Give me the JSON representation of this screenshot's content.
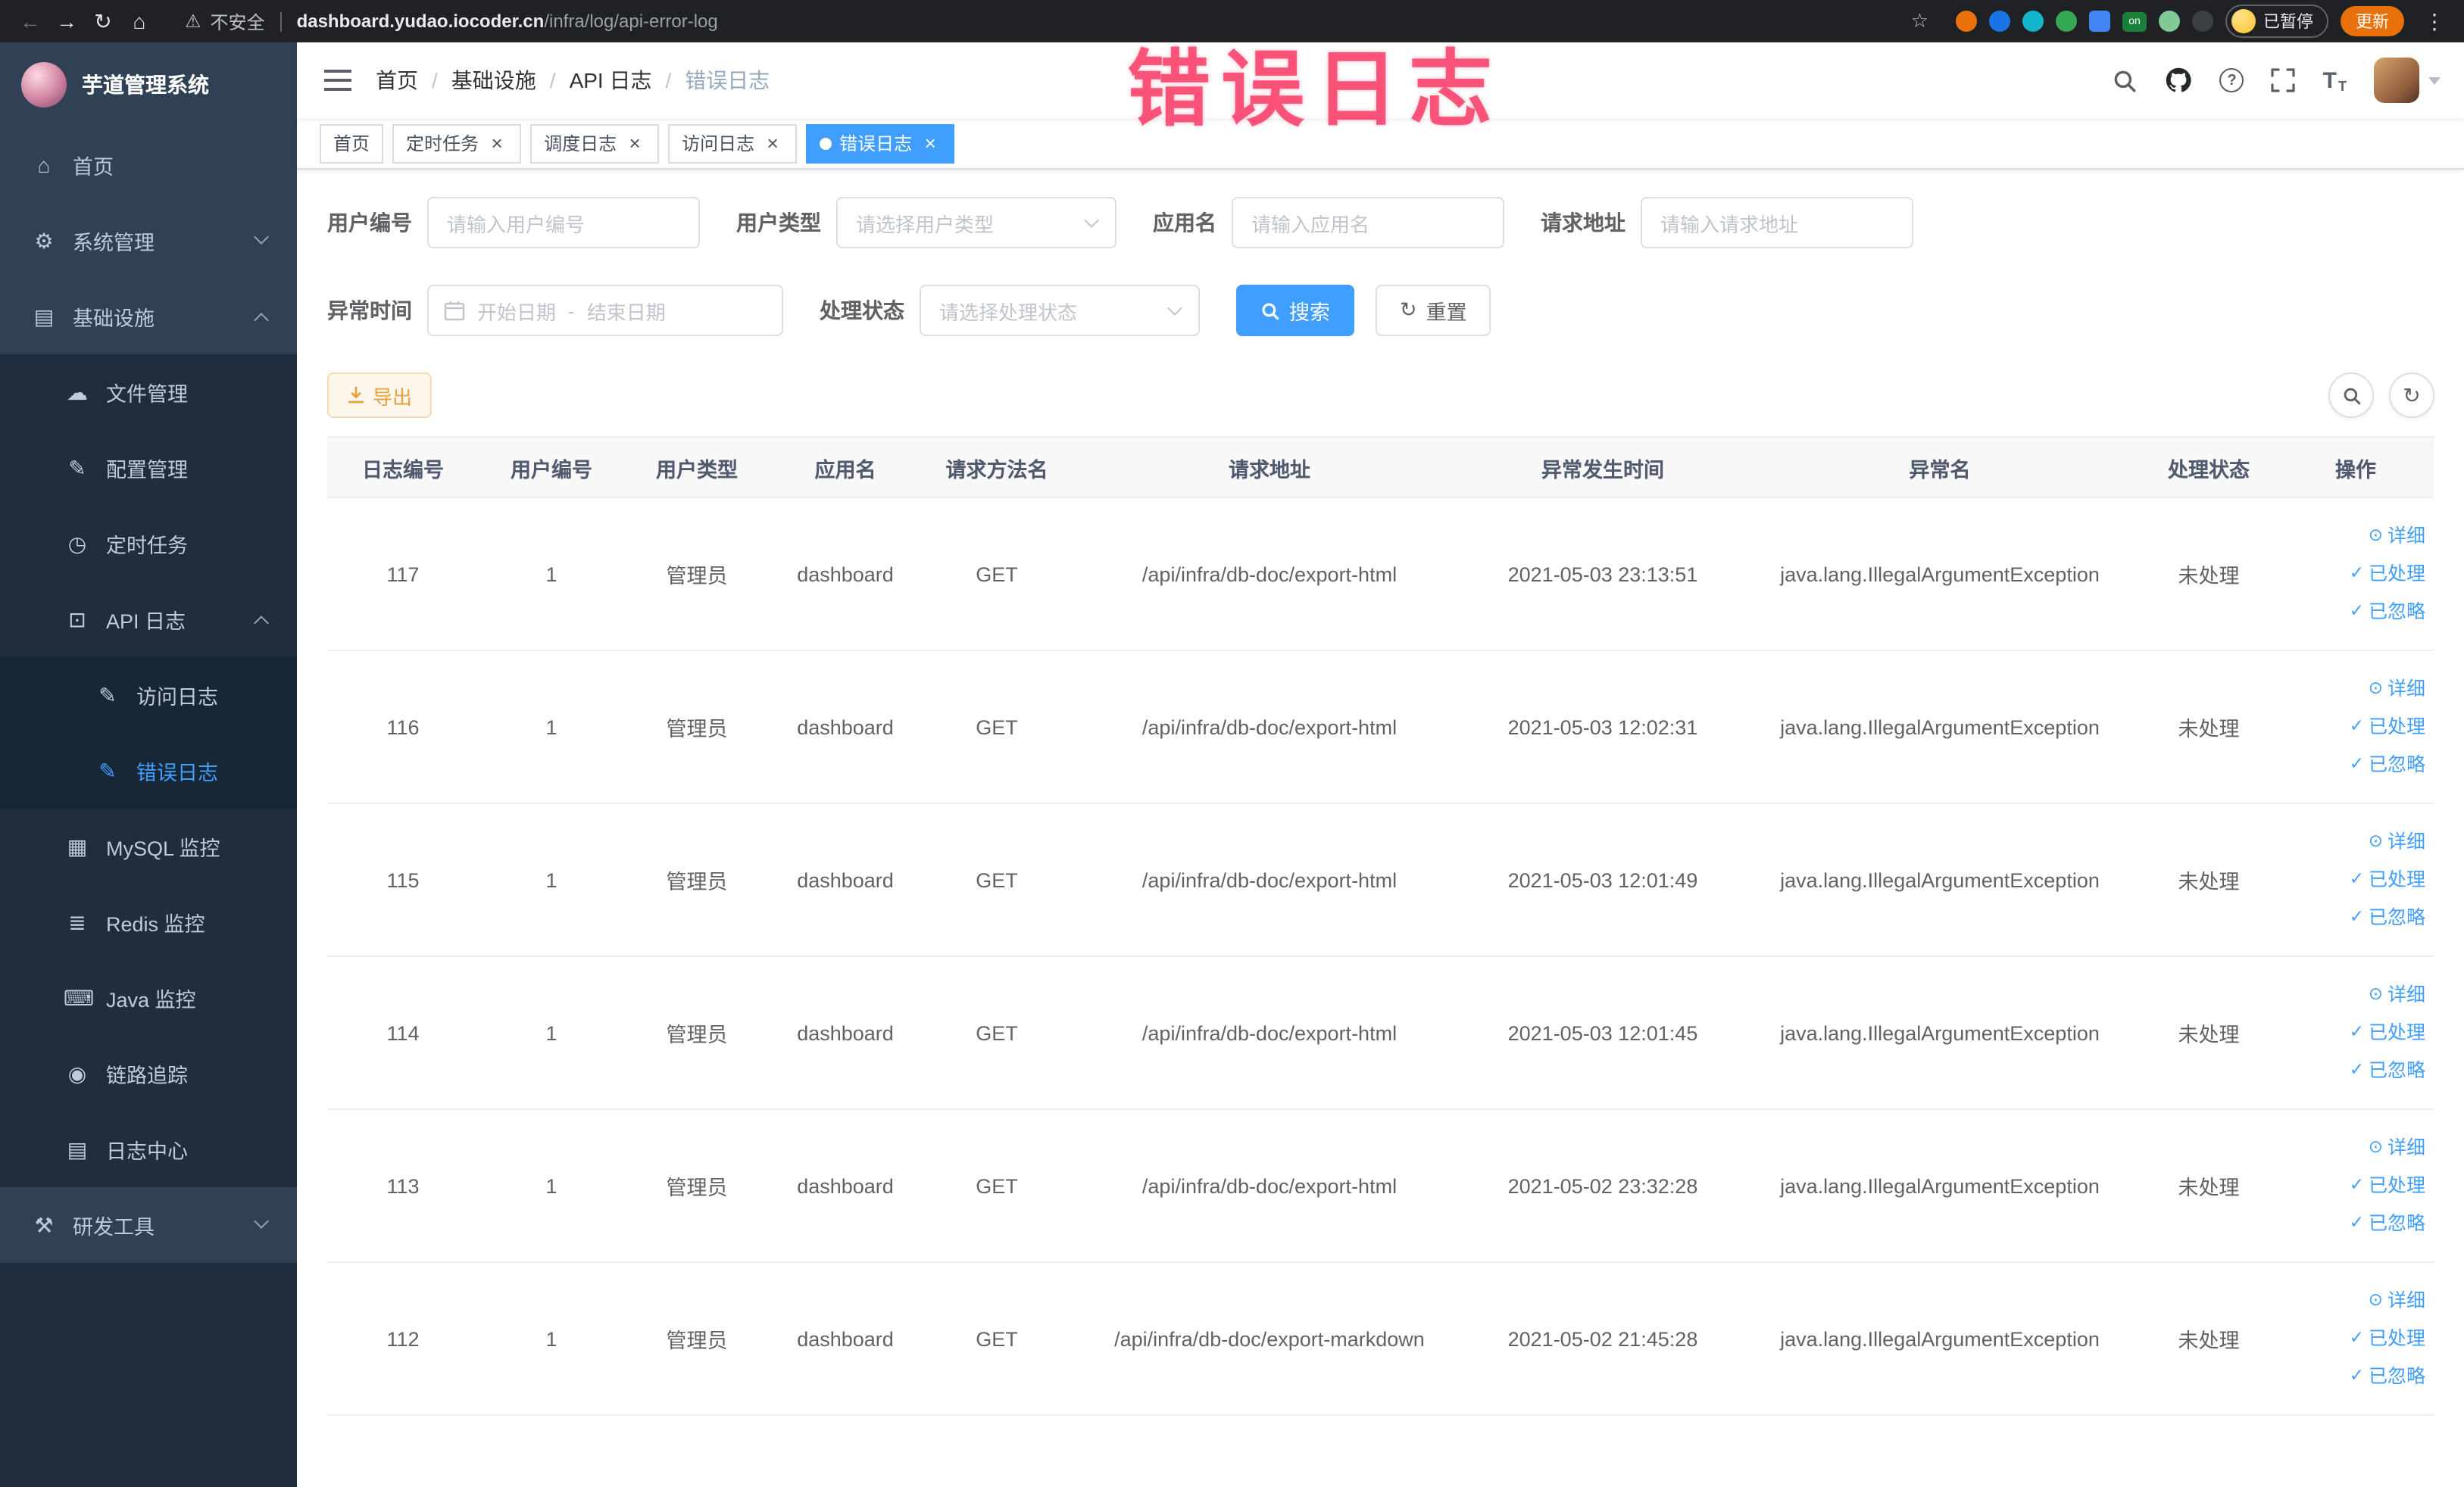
{
  "colors": {
    "accent": "#409eff",
    "warning": "#e6a23c",
    "sidebar_bg": "#304156",
    "sidebar_sub_bg": "#1f2d3d",
    "active_tag": "#409eff",
    "annotation_pink": "#f83e68"
  },
  "annotation": {
    "text": "错误日志"
  },
  "browser": {
    "security_label": "不安全",
    "url_domain": "dashboard.yudao.iocoder.cn",
    "url_path": "/infra/log/api-error-log",
    "on_badge": "on",
    "paused_badge": "已暂停",
    "update_button": "更新"
  },
  "sidebar": {
    "title": "芋道管理系统",
    "items": [
      {
        "label": "首页",
        "icon": "⌂"
      },
      {
        "label": "系统管理",
        "icon": "⚙"
      },
      {
        "label": "基础设施",
        "icon": "▤"
      },
      {
        "label": "文件管理",
        "icon": "☁"
      },
      {
        "label": "配置管理",
        "icon": "✎"
      },
      {
        "label": "定时任务",
        "icon": "◷"
      },
      {
        "label": "API 日志",
        "icon": "⊡"
      },
      {
        "label": "访问日志",
        "icon": "✎"
      },
      {
        "label": "错误日志",
        "icon": "✎"
      },
      {
        "label": "MySQL 监控",
        "icon": "▦"
      },
      {
        "label": "Redis 监控",
        "icon": "≣"
      },
      {
        "label": "Java 监控",
        "icon": "⌨"
      },
      {
        "label": "链路追踪",
        "icon": "◉"
      },
      {
        "label": "日志中心",
        "icon": "▤"
      },
      {
        "label": "研发工具",
        "icon": "⚒"
      }
    ]
  },
  "breadcrumb": {
    "separator": "/",
    "items": [
      "首页",
      "基础设施",
      "API 日志",
      "错误日志"
    ]
  },
  "tags": [
    {
      "label": "首页"
    },
    {
      "label": "定时任务"
    },
    {
      "label": "调度日志"
    },
    {
      "label": "访问日志"
    },
    {
      "label": "错误日志"
    }
  ],
  "filters": {
    "user_id_label": "用户编号",
    "user_id_placeholder": "请输入用户编号",
    "user_type_label": "用户类型",
    "user_type_placeholder": "请选择用户类型",
    "app_name_label": "应用名",
    "app_name_placeholder": "请输入应用名",
    "request_url_label": "请求地址",
    "request_url_placeholder": "请输入请求地址",
    "time_label": "异常时间",
    "time_start_placeholder": "开始日期",
    "time_separator": "-",
    "time_end_placeholder": "结束日期",
    "status_label": "处理状态",
    "status_placeholder": "请选择处理状态",
    "search_button": "搜索",
    "reset_button": "重置"
  },
  "toolbar": {
    "export_button": "导出"
  },
  "table": {
    "columns": [
      "日志编号",
      "用户编号",
      "用户类型",
      "应用名",
      "请求方法名",
      "请求地址",
      "异常发生时间",
      "异常名",
      "处理状态",
      "操作"
    ],
    "actions": [
      {
        "icon": "⊙",
        "label": "详细"
      },
      {
        "icon": "✓",
        "label": "已处理"
      },
      {
        "icon": "✓",
        "label": "已忽略"
      }
    ],
    "rows": [
      {
        "id": "117",
        "user_id": "1",
        "user_type": "管理员",
        "app": "dashboard",
        "method": "GET",
        "url": "/api/infra/db-doc/export-html",
        "time": "2021-05-03 23:13:51",
        "exception": "java.lang.IllegalArgumentException",
        "status": "未处理"
      },
      {
        "id": "116",
        "user_id": "1",
        "user_type": "管理员",
        "app": "dashboard",
        "method": "GET",
        "url": "/api/infra/db-doc/export-html",
        "time": "2021-05-03 12:02:31",
        "exception": "java.lang.IllegalArgumentException",
        "status": "未处理"
      },
      {
        "id": "115",
        "user_id": "1",
        "user_type": "管理员",
        "app": "dashboard",
        "method": "GET",
        "url": "/api/infra/db-doc/export-html",
        "time": "2021-05-03 12:01:49",
        "exception": "java.lang.IllegalArgumentException",
        "status": "未处理"
      },
      {
        "id": "114",
        "user_id": "1",
        "user_type": "管理员",
        "app": "dashboard",
        "method": "GET",
        "url": "/api/infra/db-doc/export-html",
        "time": "2021-05-03 12:01:45",
        "exception": "java.lang.IllegalArgumentException",
        "status": "未处理"
      },
      {
        "id": "113",
        "user_id": "1",
        "user_type": "管理员",
        "app": "dashboard",
        "method": "GET",
        "url": "/api/infra/db-doc/export-html",
        "time": "2021-05-02 23:32:28",
        "exception": "java.lang.IllegalArgumentException",
        "status": "未处理"
      },
      {
        "id": "112",
        "user_id": "1",
        "user_type": "管理员",
        "app": "dashboard",
        "method": "GET",
        "url": "/api/infra/db-doc/export-markdown",
        "time": "2021-05-02 21:45:28",
        "exception": "java.lang.IllegalArgumentException",
        "status": "未处理"
      }
    ]
  },
  "glyphs": {
    "back": "←",
    "forward": "→",
    "reload": "↻",
    "home": "⌂",
    "warning": "⚠",
    "star": "☆",
    "menu_dots": "⋮",
    "tag_close": "×",
    "question": "?",
    "font_large": "T",
    "font_small": "T",
    "refresh": "↻",
    "reset": "↻"
  }
}
